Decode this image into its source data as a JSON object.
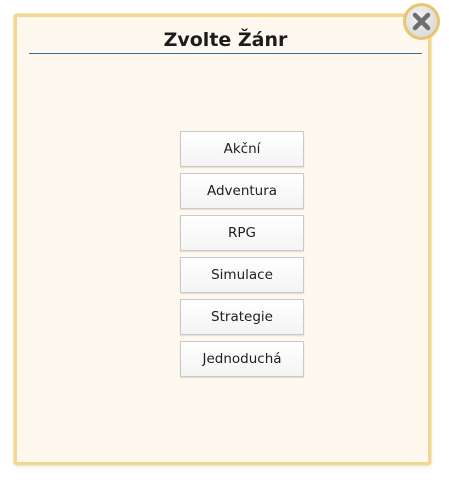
{
  "dialog": {
    "title": "Zvolte Žánr",
    "close_icon": "close-x-icon",
    "accent_border": "#f0d794",
    "background": "#fff8ee"
  },
  "genres": [
    {
      "label": "Akční"
    },
    {
      "label": "Adventura"
    },
    {
      "label": "RPG"
    },
    {
      "label": "Simulace"
    },
    {
      "label": "Strategie"
    },
    {
      "label": "Jednoduchá"
    }
  ]
}
